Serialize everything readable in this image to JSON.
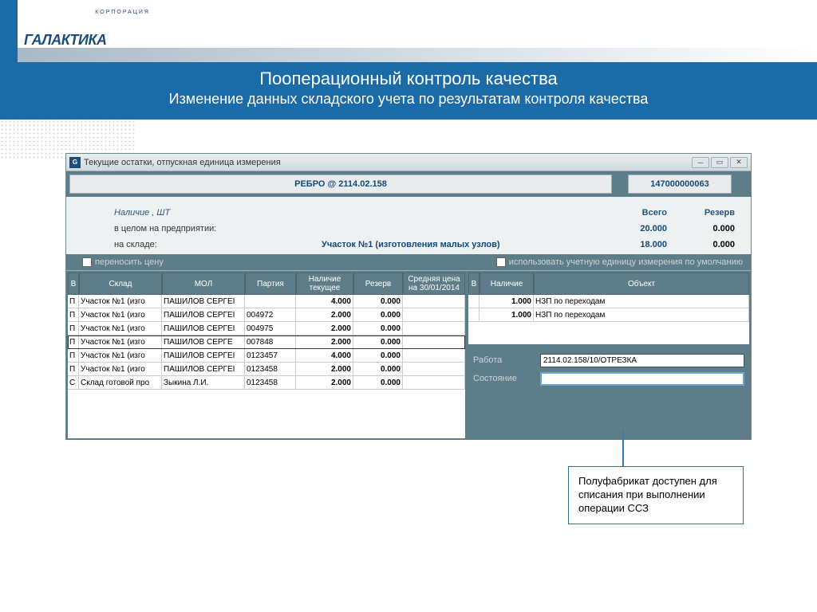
{
  "logo": {
    "name": "ГАЛАКТИКА",
    "sub": "КОРПОРАЦИЯ"
  },
  "slide": {
    "title": "Пооперационный контроль качества",
    "subtitle": "Изменение данных складского учета по результатам контроля качества"
  },
  "window": {
    "title": "Текущие остатки, отпускная единица измерения",
    "header_main": "РЕБРО @ 2114.02.158",
    "header_num": "147000000063"
  },
  "info": {
    "nal_label": "Наличие , ШТ",
    "total_label": "Всего",
    "reserve_label": "Резерв",
    "row1_label": "в целом на предприятии:",
    "row1_total": "20.000",
    "row1_reserve": "0.000",
    "row2_label": "на складе:",
    "row2_center": "Участок №1 (изготовления малых узлов)",
    "row2_total": "18.000",
    "row2_reserve": "0.000",
    "chk1": "переносить цену",
    "chk2": "использовать учетную единицу измерения по умолчанию"
  },
  "left_table": {
    "cols": [
      "В",
      "Склад",
      "МОЛ",
      "Партия",
      "Наличие текущее",
      "Резерв",
      "Средняя цена на 30/01/2014"
    ],
    "rows": [
      {
        "v": "П",
        "sklad": "Участок №1 (изго",
        "mol": "ПАШИЛОВ СЕРГЕI",
        "part": "",
        "nal": "4.000",
        "res": "0.000",
        "avg": ""
      },
      {
        "v": "П",
        "sklad": "Участок №1 (изго",
        "mol": "ПАШИЛОВ СЕРГЕI",
        "part": "004972",
        "nal": "2.000",
        "res": "0.000",
        "avg": ""
      },
      {
        "v": "П",
        "sklad": "Участок №1 (изго",
        "mol": "ПАШИЛОВ СЕРГЕI",
        "part": "004975",
        "nal": "2.000",
        "res": "0.000",
        "avg": ""
      },
      {
        "v": "П",
        "sklad": "Участок №1 (изго",
        "mol": "ПАШИЛОВ СЕРГЕ",
        "part": "007848",
        "nal": "2.000",
        "res": "0.000",
        "avg": "",
        "sel": true
      },
      {
        "v": "П",
        "sklad": "Участок №1 (изго",
        "mol": "ПАШИЛОВ СЕРГЕI",
        "part": "0123457",
        "nal": "4.000",
        "res": "0.000",
        "avg": ""
      },
      {
        "v": "П",
        "sklad": "Участок №1 (изго",
        "mol": "ПАШИЛОВ СЕРГЕI",
        "part": "0123458",
        "nal": "2.000",
        "res": "0.000",
        "avg": ""
      },
      {
        "v": "С",
        "sklad": "Склад готовой про",
        "mol": "Зыкина Л.И.",
        "part": "0123458",
        "nal": "2.000",
        "res": "0.000",
        "avg": ""
      }
    ]
  },
  "right_table": {
    "cols": [
      "В",
      "Наличие",
      "Объект"
    ],
    "rows": [
      {
        "v": "",
        "nal": "1.000",
        "obj": "НЗП по переходам"
      },
      {
        "v": "",
        "nal": "1.000",
        "obj": "НЗП по переходам"
      }
    ]
  },
  "detail": {
    "work_label": "Работа",
    "work_value": "2114.02.158/10/ОТРЕЗКА",
    "state_label": "Состояние",
    "state_value": ""
  },
  "callout": "Полуфабрикат доступен для списания при выполнении операции ССЗ"
}
